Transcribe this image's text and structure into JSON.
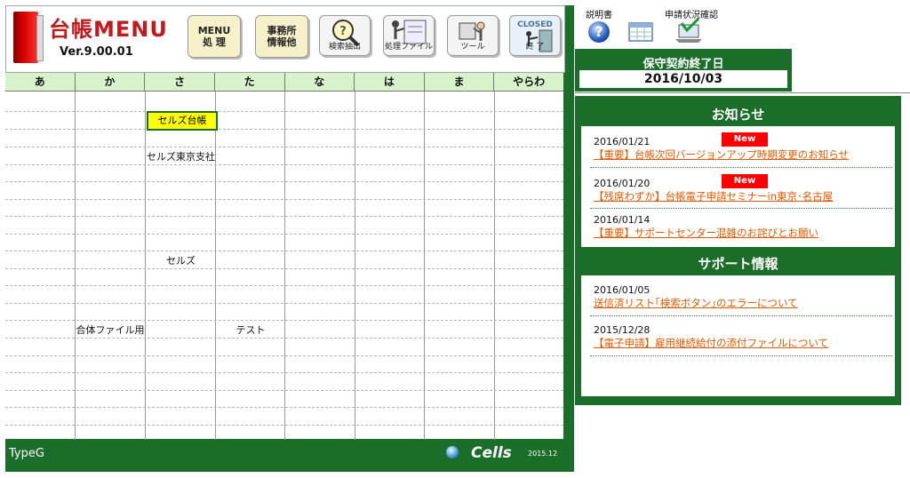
{
  "app": {
    "title": "台帳MENU",
    "version": "Ver.9.00.01"
  },
  "toolbar": {
    "menu_line1": "MENU",
    "menu_line2": "処 理",
    "office_line1": "事務所",
    "office_line2": "情報他",
    "search_label": "検索抽出",
    "process_label": "処理ファイル",
    "tool_label": "ツール",
    "closed_top": "CLOSED",
    "closed_bottom": "終 了"
  },
  "index": {
    "columns": [
      "あ",
      "か",
      "さ",
      "た",
      "な",
      "は",
      "ま",
      "やらわ"
    ],
    "selected_cell": "セルズ台帳",
    "entries": [
      "セルズ東京支社",
      "セルズ",
      "合体ファイル用",
      "テスト"
    ]
  },
  "footer": {
    "type": "TypeG",
    "brand": "Cells",
    "date": "2015.12"
  },
  "top_links": {
    "manual": "説明書",
    "status": "申請状況確認"
  },
  "maintenance": {
    "title": "保守契約終了日",
    "date": "2016/10/03"
  },
  "news": {
    "title": "お知らせ",
    "badge": "New",
    "items": [
      {
        "date": "2016/01/21",
        "text": "【重要】台帳次回バージョンアップ時期変更のお知らせ"
      },
      {
        "date": "2016/01/20",
        "text": "【残席わずか】台帳電子申請セミナーin東京･名古屋"
      },
      {
        "date": "2016/01/14",
        "text": "【重要】サポートセンター混雑のお詫びとお願い"
      }
    ]
  },
  "support": {
    "title": "サポート情報",
    "items": [
      {
        "date": "2016/01/05",
        "text": "送信済リスト｢検索ボタン｣のエラーについて"
      },
      {
        "date": "2015/12/28",
        "text": "【電子申請】雇用継続給付の添付ファイルについて"
      }
    ]
  },
  "colors": {
    "frame_green": "#1a6e2a",
    "header_green": "#d8f2cc",
    "link_orange": "#e05a00",
    "badge_red": "#ff0000"
  }
}
